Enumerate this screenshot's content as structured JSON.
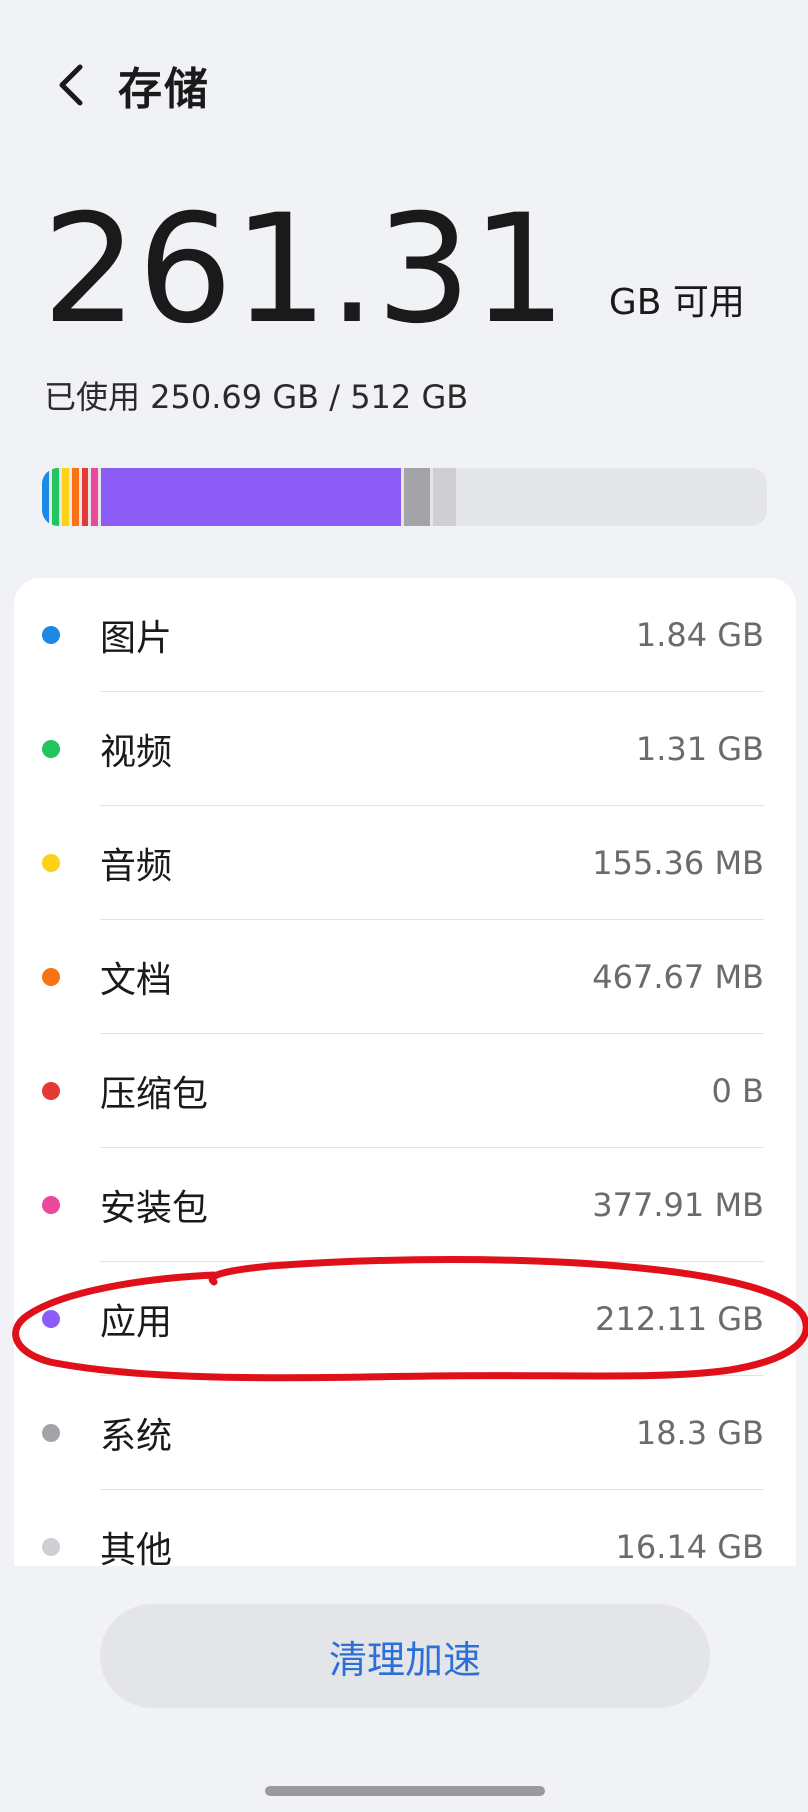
{
  "header": {
    "title": "存储"
  },
  "summary": {
    "available_value": "261.31",
    "available_unit": "GB 可用",
    "used_text": "已使用 250.69 GB / 512 GB"
  },
  "colors": {
    "background": "#f1f2f6",
    "accent": "#2c6fd6",
    "annotation": "#e0101a"
  },
  "storage_bar": {
    "total_gb": 512,
    "segments": [
      {
        "name": "图片",
        "gb": 1.84,
        "color": "#1e88e5"
      },
      {
        "name": "视频",
        "gb": 1.31,
        "color": "#22c55e"
      },
      {
        "name": "音频",
        "gb": 0.155,
        "color": "#fcd116"
      },
      {
        "name": "文档",
        "gb": 0.468,
        "color": "#f97316"
      },
      {
        "name": "压缩包",
        "gb": 0,
        "color": "#e53935"
      },
      {
        "name": "安装包",
        "gb": 0.378,
        "color": "#ec4899"
      },
      {
        "name": "应用",
        "gb": 212.11,
        "color": "#8b5cf6"
      },
      {
        "name": "系统",
        "gb": 18.3,
        "color": "#a3a3a8"
      },
      {
        "name": "其他",
        "gb": 16.14,
        "color": "#cfcfd3"
      }
    ]
  },
  "categories": [
    {
      "label": "图片",
      "value": "1.84 GB",
      "color": "#1e88e5"
    },
    {
      "label": "视频",
      "value": "1.31 GB",
      "color": "#22c55e"
    },
    {
      "label": "音频",
      "value": "155.36 MB",
      "color": "#fcd116"
    },
    {
      "label": "文档",
      "value": "467.67 MB",
      "color": "#f97316"
    },
    {
      "label": "压缩包",
      "value": "0 B",
      "color": "#e53935"
    },
    {
      "label": "安装包",
      "value": "377.91 MB",
      "color": "#ec4899"
    },
    {
      "label": "应用",
      "value": "212.11 GB",
      "color": "#8b5cf6"
    },
    {
      "label": "系统",
      "value": "18.3 GB",
      "color": "#a3a3a8"
    },
    {
      "label": "其他",
      "value": "16.14 GB",
      "color": "#cfcfd3"
    }
  ],
  "footer": {
    "clean_label": "清理加速"
  },
  "icons": {
    "back": "chevron-left-icon"
  }
}
